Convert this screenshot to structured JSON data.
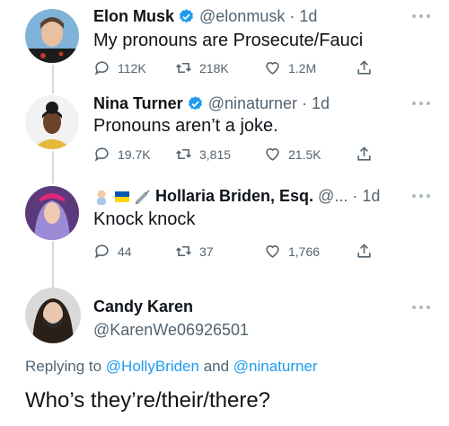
{
  "tweets": [
    {
      "name": "Elon Musk",
      "handle": "@elonmusk · 1d",
      "text": "My pronouns are Prosecute/Fauci",
      "replies": "112K",
      "retweets": "218K",
      "likes": "1.2M",
      "verified": true
    },
    {
      "name": "Nina Turner",
      "handle": "@ninaturner · 1d",
      "text": "Pronouns aren’t a joke.",
      "replies": "19.7K",
      "retweets": "3,815",
      "likes": "21.5K",
      "verified": true
    },
    {
      "name": "Hollaria Briden, Esq.",
      "handle": "@... · 1d",
      "text": "Knock knock",
      "replies": "44",
      "retweets": "37",
      "likes": "1,766",
      "name_emojis": [
        "baby-emoji",
        "ukraine-flag-emoji",
        "syringe-emoji"
      ]
    }
  ],
  "reply": {
    "name": "Candy Karen",
    "handle": "@KarenWe06926501",
    "replying_prefix": "Replying to ",
    "replying_user1": "@HollyBriden",
    "replying_and": " and ",
    "replying_user2": "@ninaturner",
    "text": "Who’s they’re/their/there?"
  },
  "colors": {
    "accent": "#1d9bf0",
    "muted": "#536471",
    "text": "#0f1419",
    "thread_line": "#cfd9de"
  }
}
